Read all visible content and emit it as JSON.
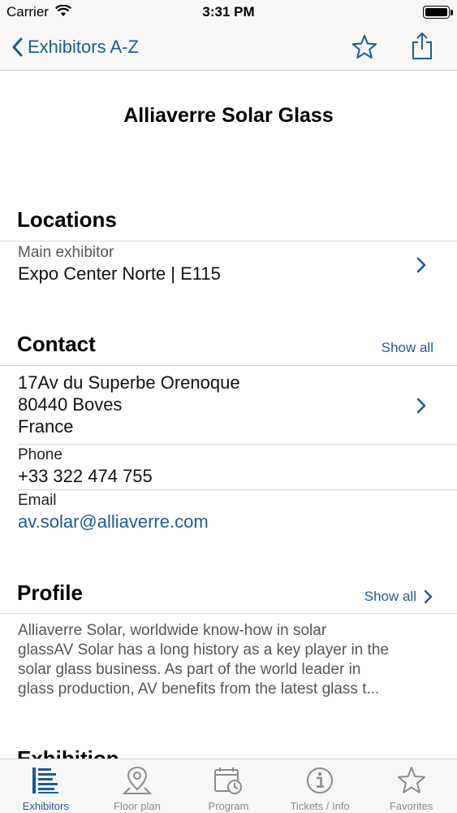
{
  "status_bar": {
    "carrier": "Carrier",
    "time": "3:31 PM"
  },
  "nav": {
    "back_label": "Exhibitors A-Z",
    "favorite_icon": "star-icon",
    "share_icon": "share-icon"
  },
  "exhibitor": {
    "name": "Alliaverre Solar Glass"
  },
  "locations": {
    "header": "Locations",
    "label": "Main exhibitor",
    "value": "Expo Center Norte | E115"
  },
  "contact": {
    "header": "Contact",
    "show_all": "Show all",
    "address_lines": [
      "17Av du Superbe Orenoque",
      "80440 Boves",
      "France"
    ],
    "phone_label": "Phone",
    "phone": "+33 322 474 755",
    "email_label": "Email",
    "email": "av.solar@alliaverre.com"
  },
  "profile": {
    "header": "Profile",
    "show_all": "Show all",
    "lines": [
      "Alliaverre Solar, worldwide know-how in solar",
      "glassAV Solar has a long history as a key player in the",
      "solar glass business. As part of the world leader in",
      "glass production, AV benefits from the latest glass t..."
    ]
  },
  "next_section": {
    "header": "Exhibition"
  },
  "tabs": [
    {
      "label": "Exhibitors",
      "icon": "list-icon",
      "active": true
    },
    {
      "label": "Floor plan",
      "icon": "map-pin-icon",
      "active": false
    },
    {
      "label": "Program",
      "icon": "calendar-clock-icon",
      "active": false
    },
    {
      "label": "Tickets / Info",
      "icon": "info-icon",
      "active": false
    },
    {
      "label": "Favorites",
      "icon": "star-icon",
      "active": false
    }
  ],
  "colors": {
    "accent": "#1d5b93",
    "inactive": "#8a8a8e",
    "bar_background": "#f7f7f7"
  }
}
